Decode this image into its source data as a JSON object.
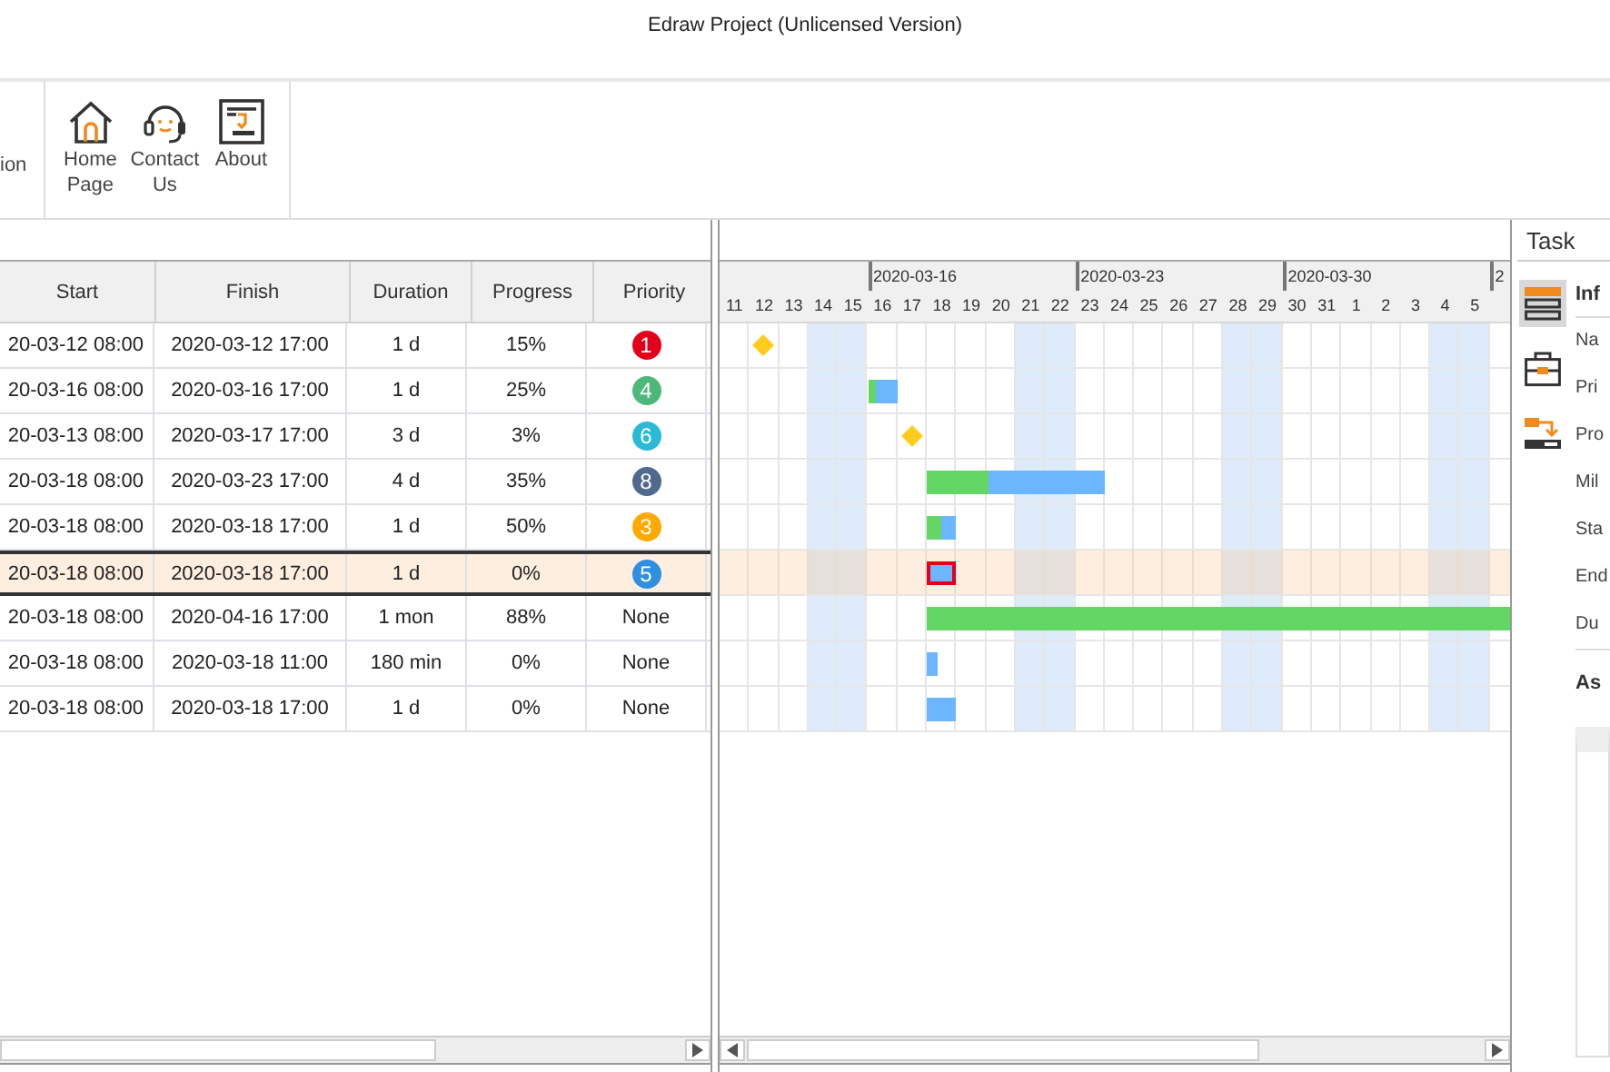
{
  "window": {
    "title": "Edraw Project (Unlicensed Version)"
  },
  "ribbon": {
    "cut_label": "ion",
    "buttons": [
      "Home Page",
      "Contact Us",
      "About"
    ]
  },
  "table": {
    "columns": [
      "Start",
      "Finish",
      "Duration",
      "Progress",
      "Priority"
    ],
    "rows": [
      {
        "start": "20-03-12 08:00",
        "finish": "2020-03-12 17:00",
        "duration": "1 d",
        "progress": "15%",
        "kind": "milestone",
        "selected": false,
        "priority": {
          "kind": "badge",
          "label": "1",
          "color": "#e2001a"
        }
      },
      {
        "start": "20-03-16 08:00",
        "finish": "2020-03-16 17:00",
        "duration": "1 d",
        "progress": "25%",
        "level": 0.25,
        "kind": "task",
        "selected": false,
        "priority": {
          "kind": "badge",
          "label": "4",
          "color": "#4cb87a"
        }
      },
      {
        "start": "20-03-13 08:00",
        "finish": "2020-03-17 17:00",
        "duration": "3 d",
        "progress": "3%",
        "kind": "milestone",
        "selected": false,
        "priority": {
          "kind": "badge",
          "label": "6",
          "color": "#2bbad6"
        }
      },
      {
        "start": "20-03-18 08:00",
        "finish": "2020-03-23 17:00",
        "duration": "4 d",
        "progress": "35%",
        "level": 0.35,
        "kind": "task",
        "selected": false,
        "priority": {
          "kind": "badge",
          "label": "8",
          "color": "#4f6a8c"
        }
      },
      {
        "start": "20-03-18 08:00",
        "finish": "2020-03-18 17:00",
        "duration": "1 d",
        "progress": "50%",
        "level": 0.5,
        "kind": "task",
        "selected": false,
        "priority": {
          "kind": "badge",
          "label": "3",
          "color": "#ffa800"
        }
      },
      {
        "start": "20-03-18 08:00",
        "finish": "2020-03-18 17:00",
        "duration": "1 d",
        "progress": "0%",
        "kind": "task",
        "selected": true,
        "priority": {
          "kind": "badge",
          "label": "5",
          "color": "#2f8fe0"
        }
      },
      {
        "start": "20-03-18 08:00",
        "finish": "2020-04-16 17:00",
        "duration": "1 mon",
        "progress": "88%",
        "level": 0.88,
        "kind": "task",
        "selected": false,
        "priority": {
          "kind": "text",
          "label": "None"
        }
      },
      {
        "start": "20-03-18 08:00",
        "finish": "2020-03-18 11:00",
        "duration": "180 min",
        "progress": "0%",
        "kind": "task",
        "selected": false,
        "priority": {
          "kind": "text",
          "label": "None"
        }
      },
      {
        "start": "20-03-18 08:00",
        "finish": "2020-03-18 17:00",
        "duration": "1 d",
        "progress": "0%",
        "kind": "task",
        "selected": false,
        "priority": {
          "kind": "text",
          "label": "None"
        }
      }
    ]
  },
  "gantt": {
    "weeks": [
      "2020-03-16",
      "2020-03-23",
      "2020-03-30",
      "2"
    ],
    "days": [
      {
        "label": "11",
        "weekend": false
      },
      {
        "label": "12",
        "weekend": false
      },
      {
        "label": "13",
        "weekend": false
      },
      {
        "label": "14",
        "weekend": true
      },
      {
        "label": "15",
        "weekend": true
      },
      {
        "label": "16",
        "weekend": false
      },
      {
        "label": "17",
        "weekend": false
      },
      {
        "label": "18",
        "weekend": false
      },
      {
        "label": "19",
        "weekend": false
      },
      {
        "label": "20",
        "weekend": false
      },
      {
        "label": "21",
        "weekend": true
      },
      {
        "label": "22",
        "weekend": true
      },
      {
        "label": "23",
        "weekend": false
      },
      {
        "label": "24",
        "weekend": false
      },
      {
        "label": "25",
        "weekend": false
      },
      {
        "label": "26",
        "weekend": false
      },
      {
        "label": "27",
        "weekend": false
      },
      {
        "label": "28",
        "weekend": true
      },
      {
        "label": "29",
        "weekend": true
      },
      {
        "label": "30",
        "weekend": false
      },
      {
        "label": "31",
        "weekend": false
      },
      {
        "label": "1",
        "weekend": false
      },
      {
        "label": "2",
        "weekend": false
      },
      {
        "label": "3",
        "weekend": false
      },
      {
        "label": "4",
        "weekend": true
      },
      {
        "label": "5",
        "weekend": true
      }
    ]
  },
  "side_panel": {
    "tab": "Task",
    "icons": [
      {
        "selected": true
      },
      {
        "selected": false
      },
      {
        "selected": false
      }
    ],
    "section_title": "Inf",
    "fields": [
      "Na",
      "Pri",
      "Pro",
      "Mil",
      "Sta",
      "End",
      "Du"
    ],
    "section2_title": "As"
  }
}
